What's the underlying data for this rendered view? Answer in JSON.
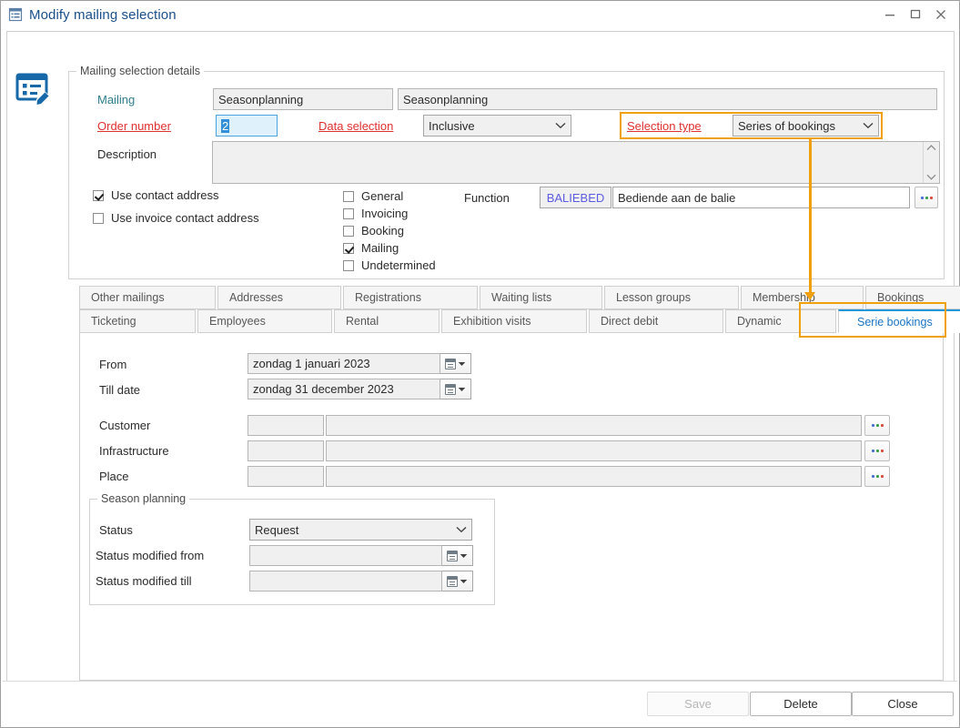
{
  "window": {
    "title": "Modify mailing selection",
    "icon": "mailing-selection-icon",
    "minimize_label": "–",
    "maximize_label": "□",
    "close_label": "×"
  },
  "details_group": {
    "legend": "Mailing selection details",
    "mailing_label": "Mailing",
    "mailing_code": "Seasonplanning",
    "mailing_name": "Seasonplanning",
    "order_number_label": "Order number",
    "order_number_value": "2",
    "data_selection_label": "Data selection",
    "data_selection_value": "Inclusive",
    "selection_type_label": "Selection type",
    "selection_type_value": "Series of bookings",
    "description_label": "Description",
    "description_value": "",
    "use_contact_address_label": "Use contact address",
    "use_contact_address_checked": true,
    "use_invoice_contact_address_label": "Use invoice contact address",
    "use_invoice_contact_address_checked": false,
    "types": [
      {
        "label": "General",
        "checked": false
      },
      {
        "label": "Invoicing",
        "checked": false
      },
      {
        "label": "Booking",
        "checked": false
      },
      {
        "label": "Mailing",
        "checked": true
      },
      {
        "label": "Undetermined",
        "checked": false
      }
    ],
    "function_label": "Function",
    "function_code": "BALIEBED",
    "function_name": "Bediende aan de balie",
    "function_browse_label": "..."
  },
  "tabs": {
    "row1": [
      "Other mailings",
      "Addresses",
      "Registrations",
      "Waiting lists",
      "Lesson groups",
      "Membership",
      "Bookings"
    ],
    "row2": [
      "Ticketing",
      "Employees",
      "Rental",
      "Exhibition visits",
      "Direct debit",
      "Dynamic",
      "Serie bookings"
    ],
    "active": "Serie bookings"
  },
  "panel": {
    "from_label": "From",
    "from_value": "zondag 1 januari 2023",
    "till_label": "Till date",
    "till_value": "zondag 31 december 2023",
    "customer_label": "Customer",
    "customer_code": "",
    "customer_name": "",
    "infrastructure_label": "Infrastructure",
    "infrastructure_code": "",
    "infrastructure_name": "",
    "place_label": "Place",
    "place_code": "",
    "place_name": "",
    "browse_label": "...",
    "season_group": {
      "legend": "Season planning",
      "status_label": "Status",
      "status_value": "Request",
      "status_from_label": "Status modified from",
      "status_from_value": "",
      "status_till_label": "Status modified till",
      "status_till_value": ""
    }
  },
  "footer": {
    "save_label": "Save",
    "save_enabled": false,
    "delete_label": "Delete",
    "close_label": "Close"
  },
  "annotation": {
    "color": "#f0a00a",
    "highlights": [
      "Selection type",
      "Serie bookings"
    ]
  }
}
